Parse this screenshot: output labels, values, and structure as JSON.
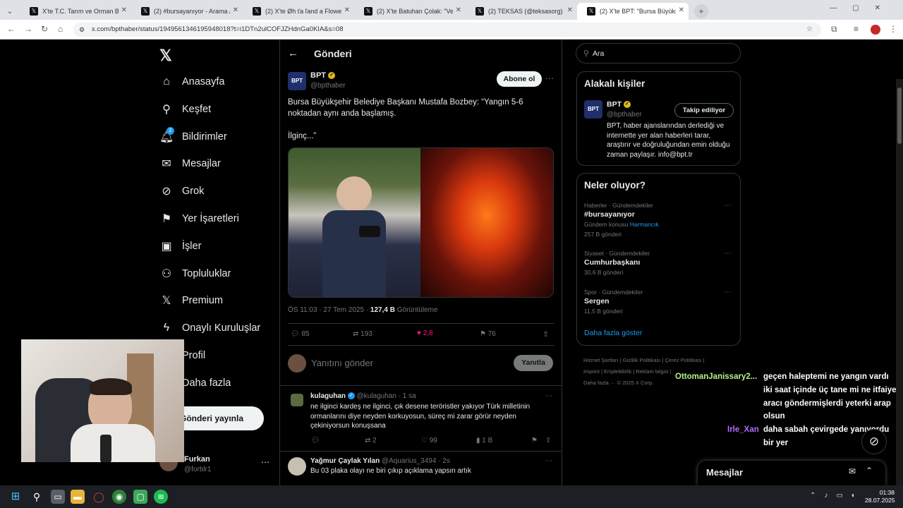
{
  "browser": {
    "tabs": [
      {
        "title": "X'te T.C. Tarım ve Orman Bakan"
      },
      {
        "title": "(2) #bursayanıyor - Arama / X"
      },
      {
        "title": "(2) X'te Øh ťa ľand a Flowerre 🌼"
      },
      {
        "title": "(2) X'te Batuhan Çolak: \"Vekilin"
      },
      {
        "title": "(2) TEKSAS (@teksasorg) / X"
      },
      {
        "title": "(2) X'te BPT: \"Bursa Büyükşehir"
      }
    ],
    "url": "x.com/bpthaber/status/1949561346195948018?t=i1DTn2ulCOFJZHdnGa0KIA&s=08"
  },
  "nav": {
    "items": [
      {
        "label": "Anasayfa",
        "icon": "home-icon"
      },
      {
        "label": "Keşfet",
        "icon": "search-icon"
      },
      {
        "label": "Bildirimler",
        "icon": "bell-icon",
        "badge": "2"
      },
      {
        "label": "Mesajlar",
        "icon": "mail-icon"
      },
      {
        "label": "Grok",
        "icon": "grok-icon"
      },
      {
        "label": "Yer İşaretleri",
        "icon": "bookmark-icon"
      },
      {
        "label": "İşler",
        "icon": "briefcase-icon"
      },
      {
        "label": "Topluluklar",
        "icon": "people-icon"
      },
      {
        "label": "Premium",
        "icon": "x-icon"
      },
      {
        "label": "Onaylı Kuruluşlar",
        "icon": "lightning-icon"
      },
      {
        "label": "Profil",
        "icon": "user-icon"
      },
      {
        "label": "Daha fazla",
        "icon": "more-icon"
      }
    ],
    "post_button": "Gönderi yayınla",
    "account": {
      "name": "Furkan",
      "handle": "@forblr1"
    }
  },
  "post": {
    "header": "Gönderi",
    "author": "BPT",
    "handle": "@bpthaber",
    "subscribe": "Abone ol",
    "text_line1": "Bursa Büyükşehir Belediye Başkanı Mustafa Bozbey: “Yangın 5-6",
    "text_line2": "noktadan aynı anda başlamış.",
    "text_line3": "İlginç...”",
    "time": "ÖS 11:03 · 27 Tem 2025 · ",
    "views": "127,4 B",
    "views_label": " Görüntüleme",
    "stats": {
      "replies": "85",
      "reposts": "193",
      "likes": "2,8",
      "bookmarks": "76"
    },
    "reply_placeholder": "Yanıtını gönder",
    "reply_button": "Yanıtla"
  },
  "replies": [
    {
      "name": "kulaguhan",
      "handle": "@kulaguhan",
      "time": "· 1 sa",
      "lines": [
        "ne ilginci kardeş ne ilginci, çık desene teröristler yakıyor Türk milletinin",
        "ormanlarını diye neyden korkuyosun, süreç mi zarar görür neyden",
        "çekiniyorsun konuşsana"
      ],
      "reposts": "2",
      "likes": "99",
      "views": "1 B"
    },
    {
      "name": "Yağmur Çaylak Yılan",
      "handle": "@Aquarius_3494",
      "time": "· 2s",
      "lines": [
        "Bu 03 plaka olayı ne biri çıkıp açıklama yapsın artık"
      ]
    }
  ],
  "right": {
    "search_placeholder": "Ara",
    "related_title": "Alakalı kişiler",
    "related": {
      "name": "BPT",
      "handle": "@bpthaber",
      "follow": "Takip ediliyor",
      "bio": [
        "BPT, haber ajanslarından derlediği ve",
        "internette yer alan haberleri tarar,",
        "araştırır ve doğruluğundan emin olduğu",
        "zaman paylaşır. info@bpt.tr"
      ]
    },
    "trends_title": "Neler oluyor?",
    "trends": [
      {
        "meta": "Haberler · Gündemdekiler",
        "name": "#bursayanıyor",
        "extra_prefix": "Gündem konusu ",
        "extra_link": "Harmancık",
        "count": "257 B gönderi"
      },
      {
        "meta": "Siyaset · Gündemdekiler",
        "name": "Cumhurbaşkanı",
        "count": "30,6 B gönderi"
      },
      {
        "meta": "Spor · Gündemdekiler",
        "name": "Sergen",
        "count": "11,5 B gönderi"
      }
    ],
    "show_more": "Daha fazla göster",
    "footer": [
      "Hizmet Şartları",
      "Gizlilik Politikası",
      "Çerez Politikası",
      "Imprint",
      "Erişilebilirlik",
      "Reklam bilgisi",
      "Daha fazla ···",
      "© 2025 X Corp."
    ],
    "messages": "Mesajlar"
  },
  "overlay_chat": [
    {
      "user": "OttomanJanissary2...",
      "msg": "geçen haleptemi ne yangın vardı",
      "user_color": "#b6f28a"
    },
    {
      "user": "",
      "msg": "iki saat içinde üç tane mi ne itfaiye"
    },
    {
      "user": "",
      "msg": "aracı göndermişlerdi yeterki arap"
    },
    {
      "user": "",
      "msg": "olsun"
    },
    {
      "user": "Irle_Xan",
      "msg": "daha sabah çevirgede yanıyordu",
      "user_color": "#b36bff"
    },
    {
      "user": "",
      "msg": "bir yer"
    }
  ],
  "taskbar": {
    "time": "01:38",
    "date": "28.07.2025"
  },
  "colors": {
    "accent": "#1d9bf0",
    "like": "#f91880",
    "verified": "#e2b719"
  }
}
